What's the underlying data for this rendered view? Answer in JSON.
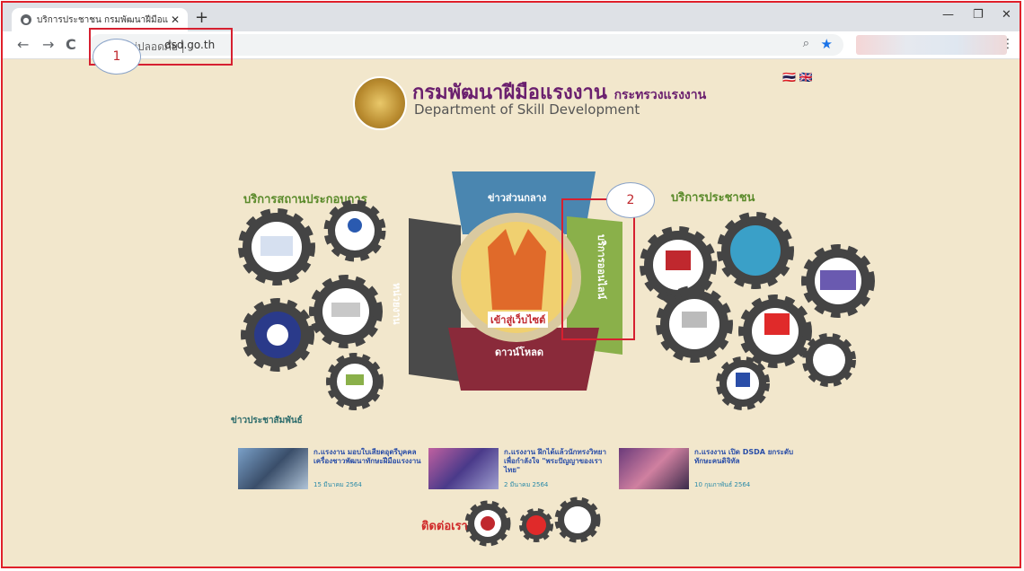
{
  "browser": {
    "tab_title": "บริการประชาชน กรมพัฒนาฝีมือแรงงาน",
    "tab_close": "✕",
    "new_tab": "+",
    "win_min": "—",
    "win_max": "❐",
    "win_close": "✕",
    "back": "←",
    "forward": "→",
    "reload": "C",
    "security_label": "ไม่ปลอดภัย |",
    "url": "dsd.go.th",
    "zoom_icon": "⌕",
    "star_icon": "★",
    "menu_icon": "⋮"
  },
  "annotations": [
    {
      "number": "1"
    },
    {
      "number": "2"
    }
  ],
  "site": {
    "title": "กรมพัฒนาฝีมือแรงงาน",
    "title_suffix": "กระทรวงแรงงาน",
    "subtitle": "Department of Skill Development",
    "flags": "🇹🇭 🇬🇧"
  },
  "sections": {
    "left_title": "บริการสถานประกอบการ",
    "right_title": "บริการประชาชน"
  },
  "center_gear": {
    "top_label": "ข่าวส่วนกลาง",
    "left_label": "หน่วยงาน",
    "right_label": "บริการออนไลน์",
    "bottom_label": "ดาวน์โหลด",
    "center_label": "เข้าสู่เว็บไซต์"
  },
  "news": {
    "heading": "ข่าวประชาสัมพันธ์",
    "items": [
      {
        "text": "ก.แรงงาน มอบใบเสียดอุตรีบุคคล เครื่องชาวพัฒนาทักษะฝีมือแรงงาน",
        "date": "15 มีนาคม 2564"
      },
      {
        "text": "ก.แรงงาน ฝึกได้แล้วนักทรงวิทยาเพื่อกำลังใจ \"พระปัญญาของเรา ไทย\"",
        "date": "2 มีนาคม 2564"
      },
      {
        "text": "ก.แรงงาน เปิด DSDA ยกระดับทักษะคนดิจิทัล",
        "date": "10 กุมภาพันธ์ 2564"
      }
    ]
  },
  "contact_label": "ติดต่อเรา",
  "colors": {
    "page_bg": "#f2e7cc",
    "gear_blue": "#4a86b0",
    "gear_green": "#8ab04a",
    "gear_dark": "#4a4a4a",
    "gear_maroon": "#8a2a3a",
    "annotation_red": "#d62030"
  }
}
